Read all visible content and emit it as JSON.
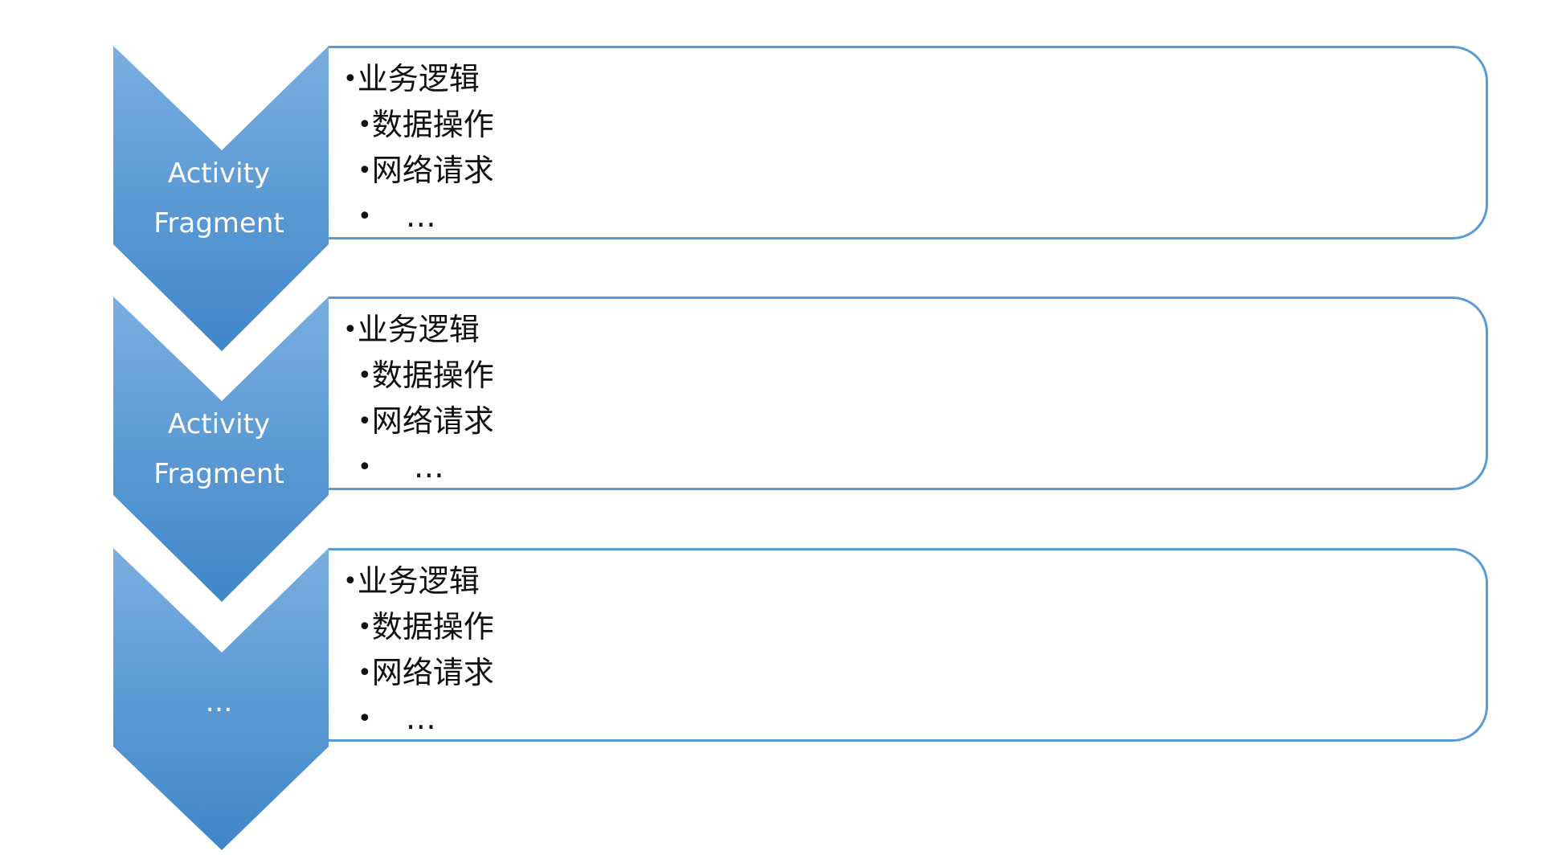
{
  "colors": {
    "chevron_light": "#7aaee0",
    "chevron_dark": "#3f86c9",
    "box_border": "#5b9bd5",
    "text": "#111111",
    "chevron_text": "#ffffff"
  },
  "stages": [
    {
      "label_lines": [
        "Activity",
        "Fragment"
      ],
      "items": [
        {
          "bullet": "•",
          "text": "业务逻辑"
        },
        {
          "bullet": "•",
          "text": "数据操作"
        },
        {
          "bullet": "•",
          "text": "网络请求"
        },
        {
          "bullet": "•",
          "text": "…"
        }
      ]
    },
    {
      "label_lines": [
        "Activity",
        "Fragment"
      ],
      "items": [
        {
          "bullet": "•",
          "text": "业务逻辑"
        },
        {
          "bullet": "•",
          "text": "数据操作"
        },
        {
          "bullet": "•",
          "text": "网络请求"
        },
        {
          "bullet": "•",
          "text": "…"
        }
      ]
    },
    {
      "label_lines": [
        "…"
      ],
      "items": [
        {
          "bullet": "•",
          "text": "业务逻辑"
        },
        {
          "bullet": "•",
          "text": "数据操作"
        },
        {
          "bullet": "•",
          "text": "网络请求"
        },
        {
          "bullet": "•",
          "text": "…"
        }
      ]
    }
  ]
}
